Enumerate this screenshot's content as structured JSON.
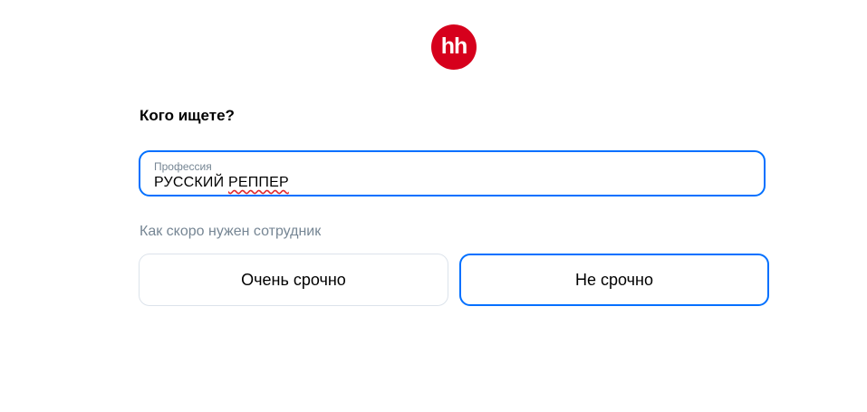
{
  "logo": {
    "text": "hh",
    "color": "#d6001c"
  },
  "form": {
    "title": "Кого ищете?",
    "profession_field": {
      "label": "Профессия",
      "value_part1": "РУССКИЙ ",
      "value_part2": "РЕППЕР"
    },
    "urgency": {
      "label": "Как скоро нужен сотрудник",
      "options": [
        {
          "label": "Очень срочно",
          "selected": false
        },
        {
          "label": "Не срочно",
          "selected": true
        }
      ]
    }
  },
  "colors": {
    "accent": "#0070ff",
    "muted_text": "#768694",
    "brand": "#d6001c"
  }
}
